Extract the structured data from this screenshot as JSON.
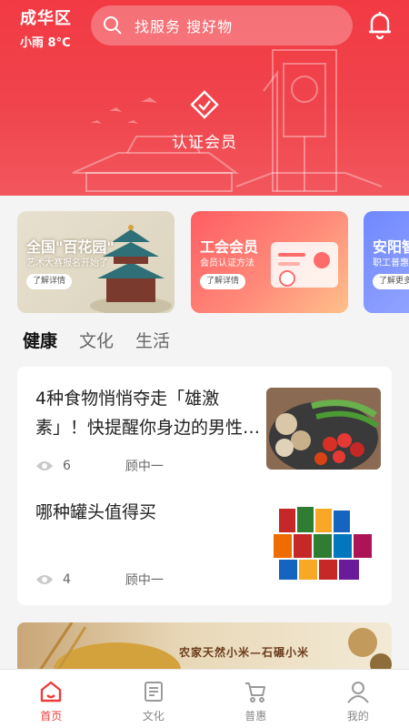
{
  "header": {
    "city": "成华区",
    "weather": "小雨 8°C",
    "search_placeholder": "找服务 搜好物",
    "cert_label": "认证会员"
  },
  "banners": [
    {
      "title": "全国\"百花园\"",
      "subtitle": "艺术大赛报名开始了",
      "button": "了解详情"
    },
    {
      "title": "工会会员",
      "subtitle": "会员认证方法",
      "button": "了解详情"
    },
    {
      "title": "安阳智",
      "subtitle": "职工普惠",
      "button": "了解更多"
    }
  ],
  "tabs": [
    "健康",
    "文化",
    "生活"
  ],
  "articles": [
    {
      "title": "4种食物悄悄夺走「雄激素」！快提醒你身边的男性…",
      "views": "6",
      "author": "顾中一"
    },
    {
      "title": "哪种罐头值得买",
      "views": "4",
      "author": "顾中一"
    }
  ],
  "ad": {
    "text": "农家天然小米—石碾小米"
  },
  "tabbar": [
    {
      "label": "首页",
      "icon": "home-icon"
    },
    {
      "label": "文化",
      "icon": "article-icon"
    },
    {
      "label": "普惠",
      "icon": "cart-icon"
    },
    {
      "label": "我的",
      "icon": "user-icon"
    }
  ],
  "colors": {
    "brand": "#f23a43",
    "active_tab": "#ee3b3b"
  }
}
